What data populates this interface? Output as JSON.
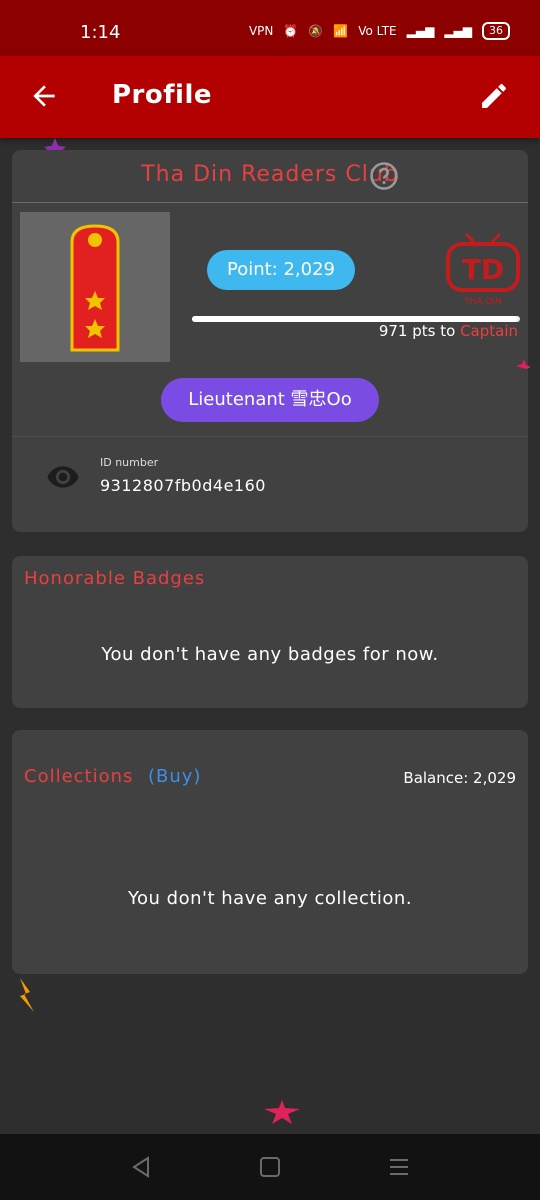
{
  "status": {
    "time": "1:14",
    "battery": "36",
    "network": "VPN",
    "lte": "Vo LTE"
  },
  "appbar": {
    "title": "Profile"
  },
  "club": {
    "title": "Tha Din Readers Club"
  },
  "points": {
    "label": "Point: 2,029",
    "progress_fraction": 0.99,
    "remaining": "971 pts to",
    "next_rank": "Captain"
  },
  "logo": {
    "text": "TD",
    "sub": "THA DIN"
  },
  "rank": {
    "label": "Lieutenant 雪忠Oo"
  },
  "id": {
    "label": "ID number",
    "value": "9312807fb0d4e160"
  },
  "badges": {
    "title": "Honorable Badges",
    "empty": "You don't have any badges for now."
  },
  "collections": {
    "title": "Collections",
    "buy": "(Buy)",
    "balance": "Balance: 2,029",
    "empty": "You don't have any collection."
  },
  "colors": {
    "appbar": "#b30000",
    "statusbar": "#8c0000",
    "accent_red": "#e74040",
    "point_blue": "#3fb8ef",
    "rank_purple": "#7a4ce3",
    "buy_blue": "#3c8fe6"
  }
}
